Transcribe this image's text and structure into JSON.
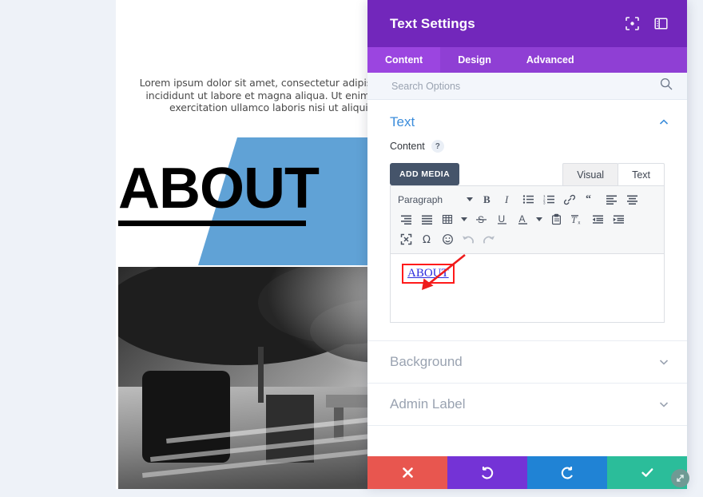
{
  "page": {
    "intro_paragraph": "Lorem ipsum dolor sit amet, consectetur adipis sed do eiusmod tempor incididunt ut labore et magna aliqua. Ut enim ad minim veniam, quis exercitation ullamco laboris nisi ut aliquip ex ea consequat.",
    "hero_title": "ABOUT",
    "hero_blue_color": "#60a2d6",
    "photo_alt": "Black and white photo of a man sitting on a bench in a park"
  },
  "modal": {
    "title": "Text Settings",
    "header_icons": [
      {
        "name": "focus-mode-icon"
      },
      {
        "name": "panel-layout-icon"
      }
    ],
    "tabs": [
      {
        "label": "Content",
        "active": true
      },
      {
        "label": "Design",
        "active": false
      },
      {
        "label": "Advanced",
        "active": false
      }
    ],
    "search": {
      "placeholder": "Search Options",
      "value": ""
    },
    "sections": [
      {
        "label": "Text",
        "expanded": true
      },
      {
        "label": "Background",
        "expanded": false
      },
      {
        "label": "Admin Label",
        "expanded": false
      }
    ],
    "content_field": {
      "label": "Content",
      "help": "?",
      "add_media_label": "ADD MEDIA",
      "editor_tabs": [
        {
          "label": "Visual",
          "active": true
        },
        {
          "label": "Text",
          "active": false
        }
      ],
      "format_select": "Paragraph",
      "toolbar_rows": [
        [
          "bold-icon",
          "italic-icon",
          "bulleted-list-icon",
          "numbered-list-icon",
          "link-icon",
          "blockquote-icon",
          "align-left-icon",
          "align-center-icon"
        ],
        [
          "align-right-icon",
          "justify-icon",
          "table-icon",
          "strikethrough-icon",
          "underline-icon",
          "text-color-icon",
          "paste-as-text-icon",
          "clear-formatting-icon",
          "outdent-icon",
          "indent-icon"
        ],
        [
          "fullscreen-icon",
          "special-character-icon",
          "emoji-icon",
          "undo-icon",
          "redo-icon"
        ]
      ],
      "editor_value": "ABOUT",
      "editor_value_link_color": "#2b2bdd",
      "highlight_color": "#ff1a1a"
    },
    "actions": [
      {
        "name": "cancel",
        "icon": "close-icon",
        "color": "#e8564f"
      },
      {
        "name": "undo",
        "icon": "undo-icon",
        "color": "#7433d6"
      },
      {
        "name": "redo",
        "icon": "redo-icon",
        "color": "#2083d5"
      },
      {
        "name": "save",
        "icon": "checkmark-icon",
        "color": "#2bbd9a"
      }
    ]
  }
}
